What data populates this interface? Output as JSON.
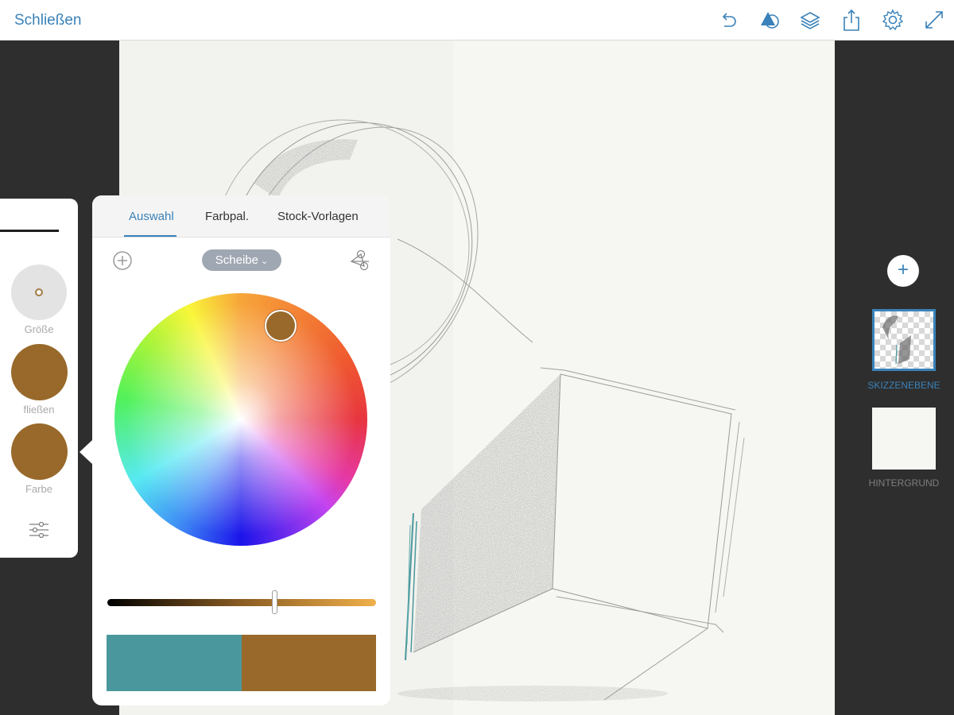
{
  "topbar": {
    "close_label": "Schließen",
    "tools": [
      "undo-icon",
      "shapes-icon",
      "layers-icon",
      "share-icon",
      "settings-icon",
      "fullscreen-icon"
    ]
  },
  "brush_panel": {
    "size_label": "Größe",
    "flow_label": "fließen",
    "color_label": "Farbe",
    "flow_color": "#98692a",
    "brush_color": "#98692a"
  },
  "color_picker": {
    "tabs": [
      "Auswahl",
      "Farbpal.",
      "Stock-Vorlagen"
    ],
    "active_tab": "Auswahl",
    "mode": "Scheibe",
    "selected_color": "#98692a",
    "previous_color": "#4a989d",
    "brightness_slider_position": 0.62
  },
  "layers": [
    {
      "label": "SKIZZENEBENE",
      "selected": true
    },
    {
      "label": "HINTERGRUND",
      "selected": false
    }
  ],
  "colors": {
    "accent": "#3a82b9",
    "toolbar_bg": "#ffffff",
    "workspace_bg": "#2e2e2e",
    "canvas_bg": "#f6f6f2"
  }
}
